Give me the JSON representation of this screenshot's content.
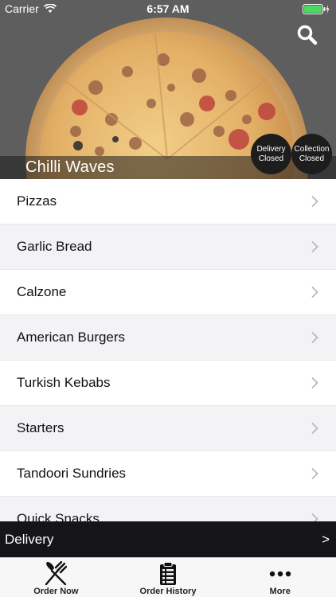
{
  "status_bar": {
    "carrier": "Carrier",
    "time": "6:57 AM",
    "wifi_icon": "wifi-icon",
    "battery_icon": "battery-charging-icon",
    "battery_color": "#4cd964"
  },
  "header": {
    "restaurant_name": "Chilli Waves",
    "search_icon": "search-icon",
    "delivery_status": {
      "line1": "Delivery",
      "line2": "Closed"
    },
    "collection_status": {
      "line1": "Collection",
      "line2": "Closed"
    }
  },
  "menu": {
    "chevron_icon": "chevron-right-icon",
    "items": [
      {
        "label": "Pizzas"
      },
      {
        "label": "Garlic Bread"
      },
      {
        "label": "Calzone"
      },
      {
        "label": "American Burgers"
      },
      {
        "label": "Turkish Kebabs"
      },
      {
        "label": "Starters"
      },
      {
        "label": "Tandoori Sundries"
      },
      {
        "label": "Quick Snacks"
      }
    ]
  },
  "delivery_bar": {
    "label": "Delivery",
    "arrow": ">"
  },
  "tab_bar": {
    "tabs": [
      {
        "label": "Order Now",
        "icon": "fork-knife-icon"
      },
      {
        "label": "Order History",
        "icon": "clipboard-icon"
      },
      {
        "label": "More",
        "icon": "more-dots-icon"
      }
    ]
  },
  "colors": {
    "dark_bar": "#151519",
    "row_alt": "#f3f3f6",
    "tab_bar_bg": "#f7f7f7"
  }
}
